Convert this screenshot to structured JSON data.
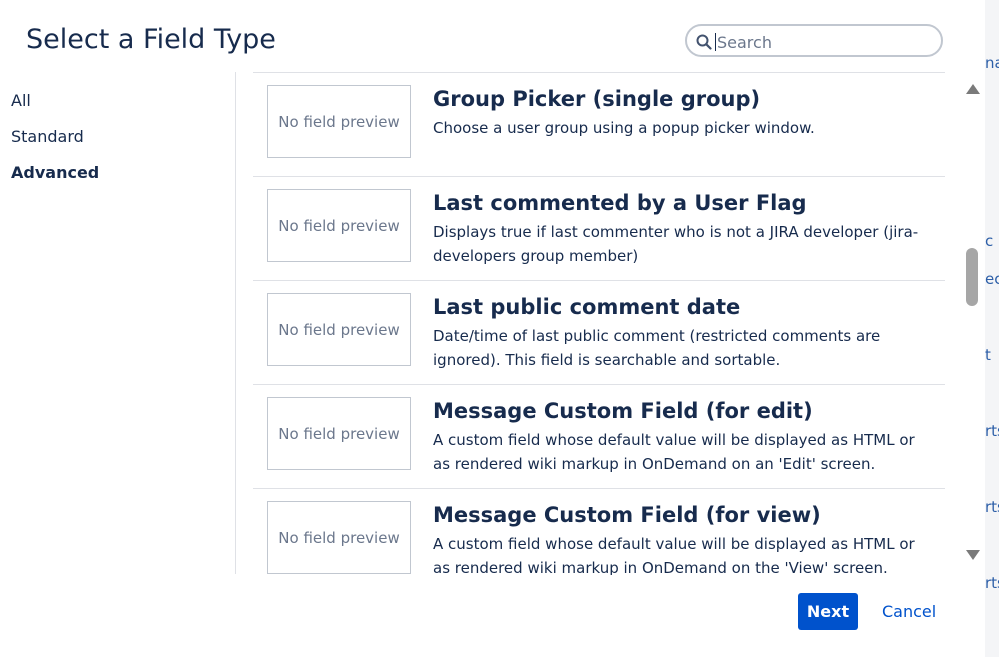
{
  "dialog": {
    "title": "Select a Field Type"
  },
  "search": {
    "placeholder": "Search",
    "value": ""
  },
  "nav": {
    "items": [
      {
        "label": "All",
        "active": false
      },
      {
        "label": "Standard",
        "active": false
      },
      {
        "label": "Advanced",
        "active": true
      }
    ]
  },
  "fields": [
    {
      "preview": "No field preview",
      "title": "Group Picker (single group)",
      "description": "Choose a user group using a popup picker window."
    },
    {
      "preview": "No field preview",
      "title": "Last commented by a User Flag",
      "description": "Displays true if last commenter who is not a JIRA developer (jira-developers group member)"
    },
    {
      "preview": "No field preview",
      "title": "Last public comment date",
      "description": "Date/time of last public comment (restricted comments are ignored). This field is searchable and sortable."
    },
    {
      "preview": "No field preview",
      "title": "Message Custom Field (for edit)",
      "description": "A custom field whose default value will be displayed as HTML or as rendered wiki markup in OnDemand on an 'Edit' screen."
    },
    {
      "preview": "No field preview",
      "title": "Message Custom Field (for view)",
      "description": "A custom field whose default value will be displayed as HTML or as rendered wiki markup in OnDemand on the 'View' screen."
    }
  ],
  "footer": {
    "next_label": "Next",
    "cancel_label": "Cancel"
  },
  "background_fragments": [
    "na",
    "c",
    "ect",
    "t",
    "rts",
    "rts",
    "rts"
  ],
  "icons": {
    "search": "search-icon"
  },
  "colors": {
    "primary": "#0052cc",
    "text": "#172b4d",
    "border": "#dfe1e6"
  }
}
